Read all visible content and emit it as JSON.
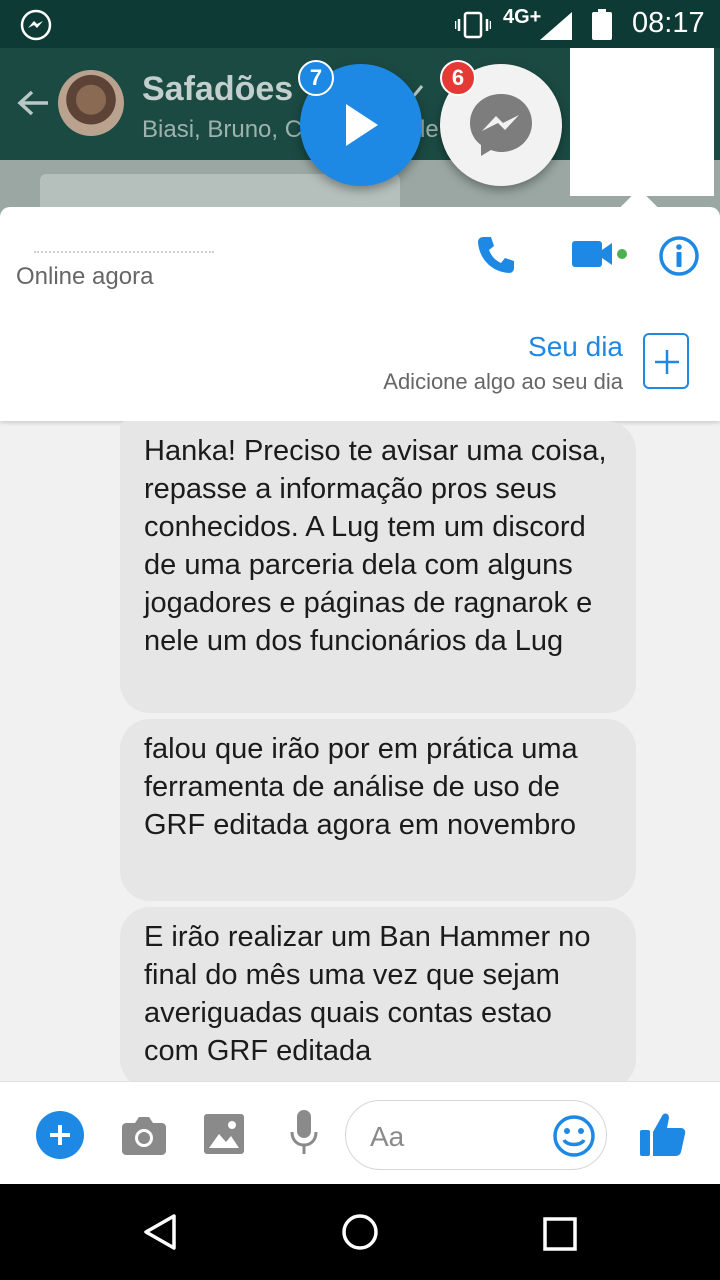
{
  "status_bar": {
    "network": "4G+",
    "time": "08:17"
  },
  "background_app": {
    "group_name": "Safadões",
    "group_members": "Biasi, Bruno, C",
    "members_overflow": "le"
  },
  "chat_heads": [
    {
      "badge": "7",
      "icon": "play-icon",
      "color": "#1e88e5"
    },
    {
      "badge": "6",
      "icon": "messenger-icon",
      "color": "#e53935"
    }
  ],
  "conversation": {
    "presence": "Online agora",
    "story_title": "Seu dia",
    "story_subtitle": "Adicione algo ao seu dia"
  },
  "messages": [
    {
      "text": "Hanka! Preciso te avisar uma coisa, repasse a informação pros seus conhecidos. A Lug tem um discord de uma parceria dela com alguns jogadores e páginas de ragnarok e nele um dos funcionários da Lug"
    },
    {
      "text": "falou que irão por em prática uma ferramenta de análise de uso de GRF editada agora em novembro"
    },
    {
      "text": "E irão realizar um Ban Hammer no final do mês uma vez que sejam averiguadas quais contas estao com GRF editada"
    }
  ],
  "composer": {
    "placeholder": "Aa"
  },
  "colors": {
    "accent": "#1e88e5",
    "bubble": "#e6e6e6",
    "online_dot": "#4caf50"
  }
}
